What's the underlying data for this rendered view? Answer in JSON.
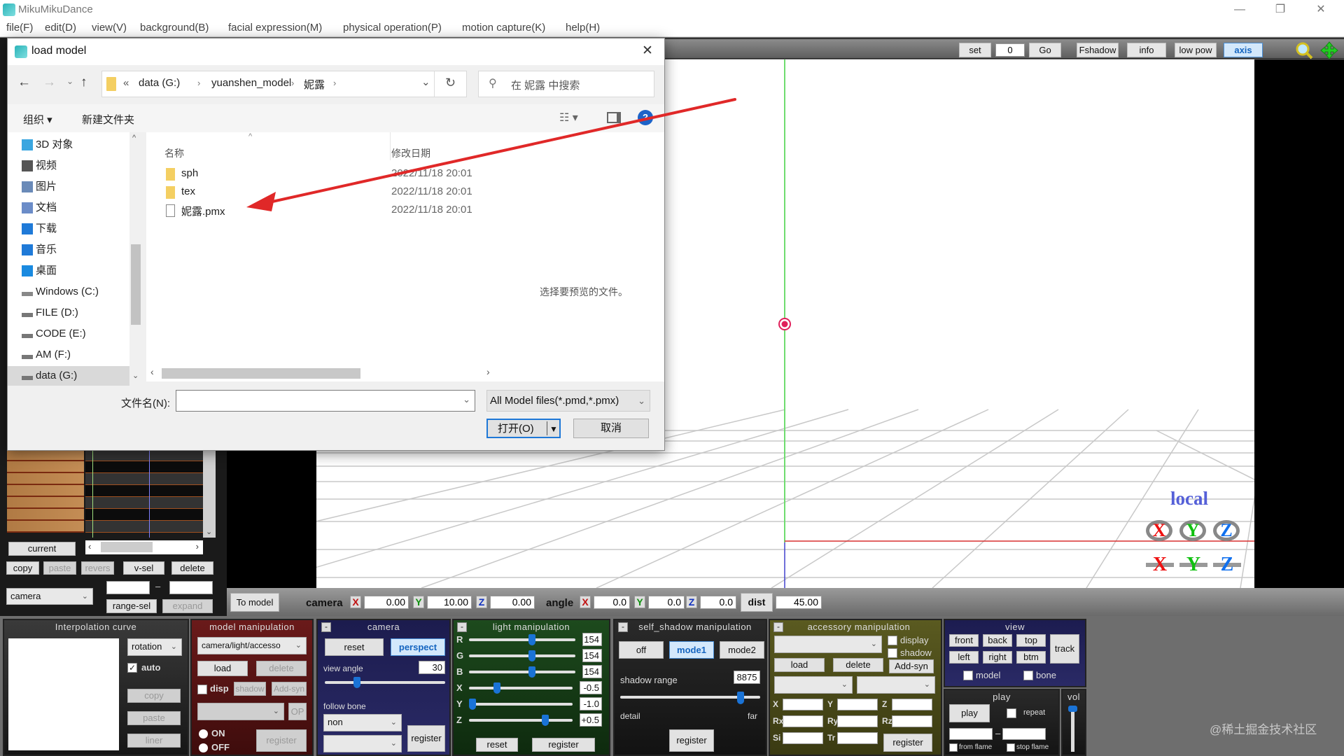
{
  "app": {
    "title": "MikuMikuDance",
    "window_controls": {
      "minimize": "—",
      "restore": "❐",
      "close": "✕"
    }
  },
  "menu": [
    "file(F)",
    "edit(D)",
    "view(V)",
    "background(B)",
    "facial expression(M)",
    "physical operation(P)",
    "motion capture(K)",
    "help(H)"
  ],
  "toolbar": {
    "set_label": "set",
    "frame_value": "0",
    "go_label": "Go",
    "fshadow_label": "Fshadow",
    "info_label": "info",
    "lowpow_label": "low pow",
    "axis_label": "axis",
    "zoom_icon": "magnifier-icon",
    "move_icon": "move-cross-icon"
  },
  "dialog": {
    "title": "load model",
    "close": "✕",
    "breadcrumb": [
      "«",
      "data (G:)",
      "yuanshen_model",
      "妮露"
    ],
    "search_placeholder": "在 妮露 中搜索",
    "organize_label": "组织 ▾",
    "new_folder_label": "新建文件夹",
    "help_icon": "?",
    "nav_items": [
      {
        "label": "3D 对象",
        "icon": "3d-objects-icon"
      },
      {
        "label": "视频",
        "icon": "video-icon"
      },
      {
        "label": "图片",
        "icon": "pictures-icon"
      },
      {
        "label": "文档",
        "icon": "documents-icon"
      },
      {
        "label": "下载",
        "icon": "download-icon"
      },
      {
        "label": "音乐",
        "icon": "music-icon"
      },
      {
        "label": "桌面",
        "icon": "desktop-icon"
      },
      {
        "label": "Windows  (C:)",
        "icon": "drive-icon"
      },
      {
        "label": "FILE (D:)",
        "icon": "drive-icon"
      },
      {
        "label": "CODE (E:)",
        "icon": "drive-icon"
      },
      {
        "label": "AM (F:)",
        "icon": "drive-icon"
      },
      {
        "label": "data (G:)",
        "icon": "drive-icon"
      }
    ],
    "columns": {
      "name": "名称",
      "modified": "修改日期"
    },
    "files": [
      {
        "name": "sph",
        "type": "folder",
        "modified": "2022/11/18 20:01"
      },
      {
        "name": "tex",
        "type": "folder",
        "modified": "2022/11/18 20:01"
      },
      {
        "name": "妮露.pmx",
        "type": "file",
        "modified": "2022/11/18 20:01"
      }
    ],
    "preview_text": "选择要预览的文件。",
    "filename_label": "文件名(N):",
    "filename_value": "",
    "filetype": "All Model files(*.pmd,*.pmx)",
    "open_label": "打开(O)",
    "cancel_label": "取消"
  },
  "timeline": {
    "current_label": "current",
    "buttons": {
      "copy": "copy",
      "paste": "paste",
      "revers": "revers",
      "vsel": "v-sel",
      "delete": "delete",
      "range_sel": "range-sel",
      "expand": "expand"
    },
    "target_select": "camera",
    "range_dash": "–"
  },
  "camera_bar": {
    "to_model": "To model",
    "camera_label": "camera",
    "x_label": "X",
    "y_label": "Y",
    "z_label": "Z",
    "cam_x": "0.00",
    "cam_y": "10.00",
    "cam_z": "0.00",
    "angle_label": "angle",
    "angle_x": "0.0",
    "angle_y": "0.0",
    "angle_z": "0.0",
    "dist_label": "dist",
    "dist": "45.00"
  },
  "viewport": {
    "local_label": "local",
    "axes": [
      "X",
      "Y",
      "Z"
    ]
  },
  "interpolation": {
    "title": "Interpolation curve",
    "select": "rotation",
    "auto_label": "auto",
    "auto_checked": true,
    "copy": "copy",
    "paste": "paste",
    "liner": "liner"
  },
  "model_manip": {
    "title": "model manipulation",
    "select": "camera/light/accesso",
    "load": "load",
    "delete": "delete",
    "disp": "disp",
    "shadow": "shadow",
    "addsyn": "Add-syn",
    "op": "OP",
    "on": "ON",
    "off": "OFF",
    "register": "register"
  },
  "camera_panel": {
    "title": "camera",
    "reset": "reset",
    "perspect": "perspect",
    "view_angle_label": "view angle",
    "view_angle": "30",
    "view_angle_fraction": 0.25,
    "follow_bone_label": "follow bone",
    "follow_bone": "non",
    "register": "register"
  },
  "light_panel": {
    "title": "light manipulation",
    "rows": [
      {
        "label": "R",
        "value": "154",
        "fraction": 0.6
      },
      {
        "label": "G",
        "value": "154",
        "fraction": 0.6
      },
      {
        "label": "B",
        "value": "154",
        "fraction": 0.6
      },
      {
        "label": "X",
        "value": "-0.5",
        "fraction": 0.25
      },
      {
        "label": "Y",
        "value": "-1.0",
        "fraction": 0.0
      },
      {
        "label": "Z",
        "value": "+0.5",
        "fraction": 0.75
      }
    ],
    "reset": "reset",
    "register": "register"
  },
  "shadow_panel": {
    "title": "self_shadow manipulation",
    "off": "off",
    "mode1": "mode1",
    "mode2": "mode2",
    "range_label": "shadow range",
    "range_value": "8875",
    "range_fraction": 0.88,
    "detail": "detail",
    "far": "far",
    "register": "register"
  },
  "accessory_panel": {
    "title": "accessory manipulation",
    "display": "display",
    "shadow": "shadow",
    "load": "load",
    "delete": "delete",
    "addsyn": "Add-syn",
    "fields": [
      "X",
      "Y",
      "Z",
      "Rx",
      "Ry",
      "Rz",
      "Si",
      "Tr"
    ],
    "register": "register"
  },
  "view_panel": {
    "title": "view",
    "buttons": [
      "front",
      "back",
      "top",
      "left",
      "right",
      "btm"
    ],
    "track": "track",
    "model": "model",
    "bone": "bone"
  },
  "play_panel": {
    "title": "play",
    "play": "play",
    "repeat": "repeat",
    "from_flame": "from flame",
    "stop_flame": "stop flame",
    "dash": "–"
  },
  "vol_panel": {
    "title": "vol",
    "level": 1.0
  },
  "watermark": "@稀土掘金技术社区",
  "colors": {
    "accent_blue": "#1a73d6",
    "x_axis": "#d32020",
    "y_axis": "#1aa020",
    "z_axis": "#1a40d0",
    "annotation_arrow": "#e23030"
  }
}
